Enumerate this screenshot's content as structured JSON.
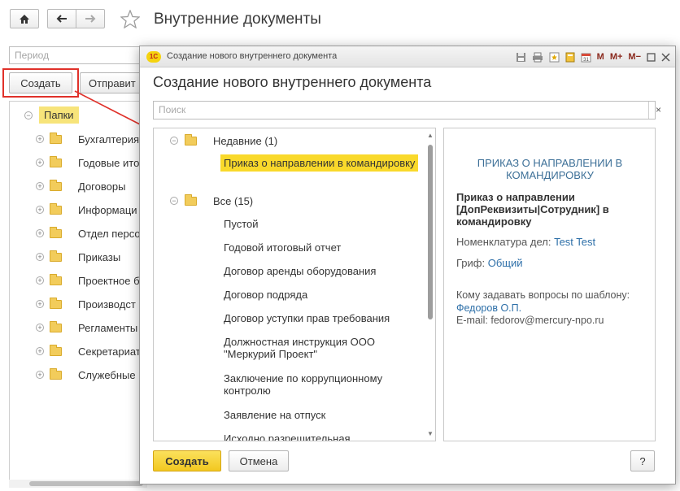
{
  "main": {
    "title": "Внутренние документы",
    "period_placeholder": "Период",
    "create_button": "Создать",
    "send_button": "Отправит",
    "tree": {
      "root": "Папки",
      "items": [
        "Бухгалтерия",
        "Годовые итог",
        "Договоры",
        "Информаци",
        "Отдел персо",
        "Приказы",
        "Проектное б",
        "Производст",
        "Регламенты",
        "Секретариат",
        "Служебные"
      ]
    }
  },
  "dialog": {
    "titlebar": "Создание нового внутреннего документа",
    "logo": "1С",
    "toolbar_m_buttons": [
      "M",
      "M+",
      "M−"
    ],
    "heading": "Создание нового внутреннего документа",
    "search_placeholder": "Поиск",
    "search_clear": "×",
    "groups": {
      "recent": {
        "label": "Недавние (1)",
        "items": [
          "Приказ о направлении в командировку"
        ]
      },
      "all": {
        "label": "Все (15)",
        "items": [
          "Пустой",
          "Годовой итоговый отчет",
          "Договор аренды оборудования",
          "Договор подряда",
          "Договор уступки прав требования",
          "Должностная инструкция ООО \"Меркурий Проект\"",
          "Заключение по коррупционному контролю",
          "Заявление на отпуск",
          "Исходно разрешительная"
        ]
      }
    },
    "info": {
      "title": "ПРИКАЗ О НАПРАВЛЕНИИ В КОМАНДИРОВКУ",
      "description": "Приказ о направлении [ДопРеквизиты|Сотрудник] в командировку",
      "nomenclature_label": "Номенклатура дел:",
      "nomenclature_value": "Test Test",
      "grif_label": "Гриф:",
      "grif_value": "Общий",
      "contact_label": "Кому задавать вопросы по шаблону:",
      "contact_name": "Федоров О.П.",
      "email_line": "E-mail: fedorov@mercury-npo.ru"
    },
    "buttons": {
      "create": "Создать",
      "cancel": "Отмена",
      "help": "?"
    }
  },
  "colors": {
    "selection": "#f9d92b",
    "link": "#2d6fa8",
    "highlight_box": "#e0312a",
    "primary_button": "#f2c820"
  }
}
